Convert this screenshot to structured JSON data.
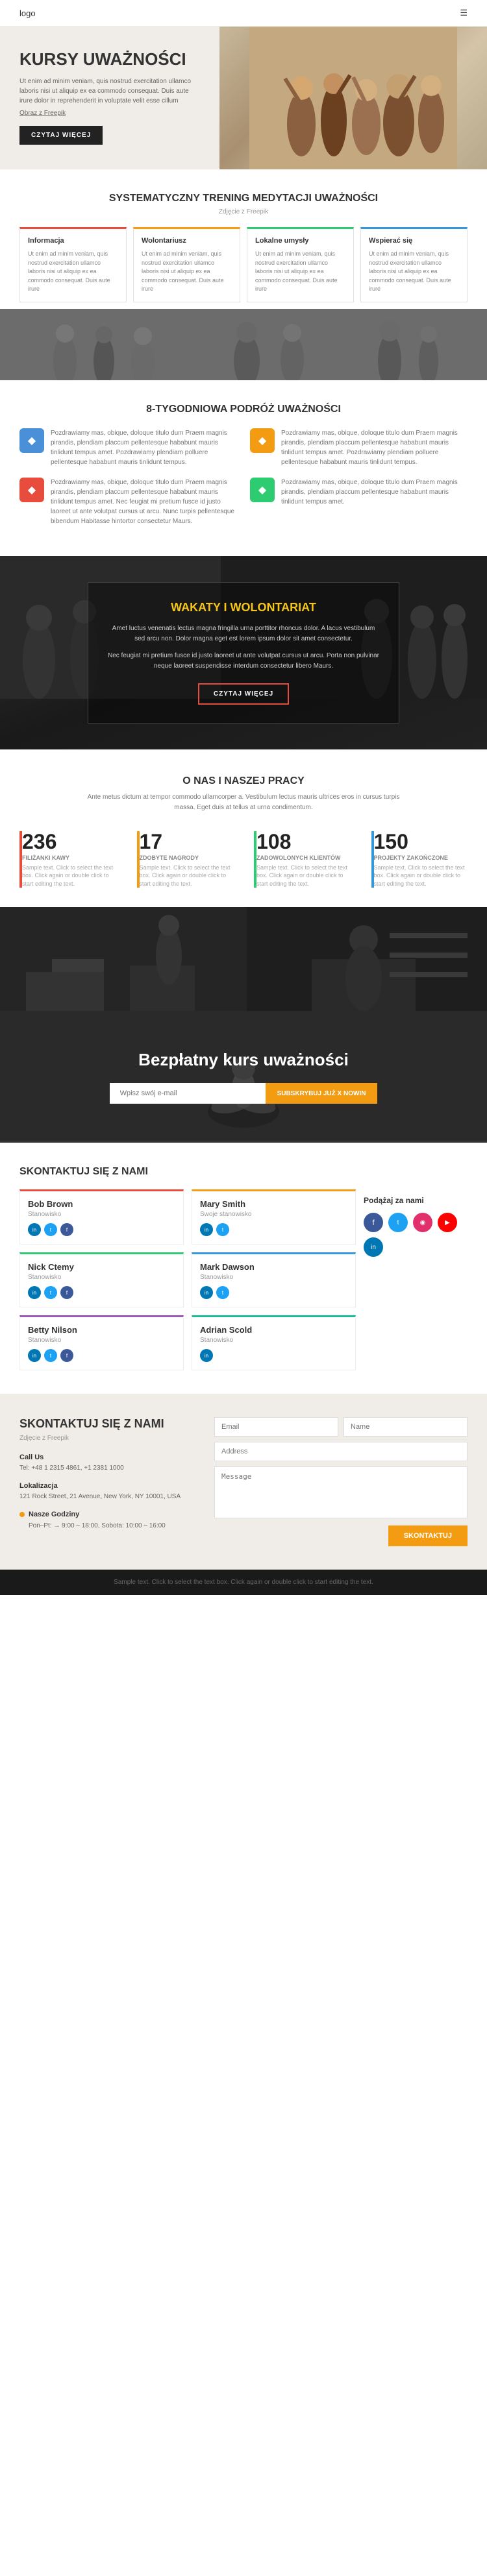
{
  "nav": {
    "logo": "logo",
    "menu_icon": "☰"
  },
  "hero": {
    "title": "KURSY UWAŻNOŚCI",
    "body": "Ut enim ad minim veniam, quis nostrud exercitation ullamco laboris nisi ut aliquip ex ea commodo consequat. Duis aute irure dolor in reprehenderit in voluptate velit esse cillum",
    "link_label": "Obraz z Freepik",
    "btn_label": "CZYTAJ WIĘCEJ"
  },
  "section2": {
    "title": "SYSTEMATYCZNY TRENING MEDYTACJI UWAŻNOŚCI",
    "sub": "Zdjęcie z Freepik",
    "cards": [
      {
        "title": "Informacja",
        "color_class": "card-info",
        "text": "Ut enim ad minim veniam, quis nostrud exercitation ullamco laboris nisi ut aliquip ex ea commodo consequat. Duis aute irure"
      },
      {
        "title": "Wolontariusz",
        "color_class": "card-vol",
        "text": "Ut enim ad minim veniam, quis nostrud exercitation ullamco laboris nisi ut aliquip ex ea commodo consequat. Duis aute irure"
      },
      {
        "title": "Lokalne umysły",
        "color_class": "card-local",
        "text": "Ut enim ad minim veniam, quis nostrud exercitation ullamco laboris nisi ut aliquip ex ea commodo consequat. Duis aute irure"
      },
      {
        "title": "Wspierać się",
        "color_class": "card-wspier",
        "text": "Ut enim ad minim veniam, quis nostrud exercitation ullamco laboris nisi ut aliquip ex ea commodo consequat. Duis aute irure"
      }
    ]
  },
  "section3": {
    "title": "8-TYGODNIOWA PODRÓŻ UWAŻNOŚCI",
    "items_left": [
      {
        "icon": "◆",
        "icon_class": "icon-blue",
        "text": "Pozdrawiamy mas, obique, doloque titulo dum Praem magnis pirandis, plendiam placcum pellentesque hababunt mauris tinlidunt tempus amet. Pozdrawiamy plendiam polluere pellentesque hababunt mauris tinlidunt tempus."
      },
      {
        "icon": "◆",
        "icon_class": "icon-red",
        "text": "Pozdrawiamy mas, obique, doloque titulo dum Praem magnis pirandis, plendiam placcum pellentesque hababunt mauris tinlidunt tempus amet. Nec feugiat mi pretium fusce id justo laoreet ut ante volutpat cursus ut arcu. Nunc turpis pellentesque bibendum Habitasse hintortor consectetur Maurs."
      }
    ],
    "items_right": [
      {
        "icon": "◆",
        "icon_class": "icon-yellow",
        "text": "Pozdrawiamy mas, obique, doloque titulo dum Praem magnis pirandis, plendiam placcum pellentesque hababunt mauris tinlidunt tempus amet. Pozdrawiamy plendiam polluere pellentesque hababunt mauris tinlidunt tempus."
      },
      {
        "icon": "◆",
        "icon_class": "icon-green",
        "text": "Pozdrawiamy mas, obique, doloque titulo dum Praem magnis pirandis, plendiam placcum pellentesque hababunt mauris tinlidunt tempus amet."
      }
    ]
  },
  "wakaty": {
    "title": "WAKATY I WOLONTARIAT",
    "text1": "Amet luctus venenatis lectus magna fringilla urna porttitor rhoncus dolor. A lacus vestibulum sed arcu non. Dolor magna eget est lorem ipsum dolor sit amet consectetur.",
    "text2": "Nec feugiat mi pretium fusce id justo laoreet ut ante volutpat cursus ut arcu. Porta non pulvinar neque laoreet suspendisse interdum consectetur libero Maurs.",
    "btn_label": "CZYTAJ WIĘCEJ"
  },
  "onas": {
    "title": "O NAS I NASZEJ PRACY",
    "desc": "Ante metus dictum at tempor commodo ullamcorper a. Vestibulum lectus mauris ultrices eros in cursus turpis massa. Eget duis at tellus at urna condimentum.",
    "stats": [
      {
        "number": "236",
        "label": "FILIŻANKI KAWY",
        "desc": "Sample text. Click to select the text box. Click again or double click to start editing the text."
      },
      {
        "number": "17",
        "label": "ZDOBYTE NAGRODY",
        "desc": "Sample text. Click to select the text box. Click again or double click to start editing the text."
      },
      {
        "number": "108",
        "label": "ZADOWOLONYCH KLIENTÓW",
        "desc": "Sample text. Click to select the text box. Click again or double click to start editing the text."
      },
      {
        "number": "150",
        "label": "PROJEKTY ZAKOŃCZONE",
        "desc": "Sample text. Click to select the text box. Click again or double click to start editing the text."
      }
    ]
  },
  "free_course": {
    "title": "Bezpłatny kurs uważności",
    "search_placeholder": "Wpisz swój e-mail",
    "btn_label": "Subskrybuj już x nowin"
  },
  "kontakt": {
    "title": "SKONTAKTUJ SIĘ Z NAMI",
    "team": [
      {
        "name": "Bob Brown",
        "role": "Stanowisko",
        "color_class": "team-card-red",
        "socials": [
          "si-linkedin",
          "si-twitter",
          "si-fb"
        ]
      },
      {
        "name": "Mary Smith",
        "role": "Swoje stanowisko",
        "color_class": "team-card-yellow",
        "socials": [
          "si-linkedin",
          "si-twitter"
        ]
      },
      {
        "name": "Nick Ctemy",
        "role": "Stanowisko",
        "color_class": "team-card-green",
        "socials": [
          "si-linkedin",
          "si-twitter",
          "si-fb"
        ]
      },
      {
        "name": "Mark Dawson",
        "role": "Stanowisko",
        "color_class": "team-card-blue",
        "socials": [
          "si-linkedin",
          "si-twitter"
        ]
      },
      {
        "name": "Betty Nilson",
        "role": "Stanowisko",
        "color_class": "team-card-purple",
        "socials": [
          "si-linkedin",
          "si-twitter",
          "si-fb"
        ]
      },
      {
        "name": "Adrian Scold",
        "role": "Stanowisko",
        "color_class": "team-card-teal",
        "socials": [
          "si-linkedin"
        ]
      }
    ],
    "follow_title": "Podążaj za nami",
    "follow_icons": [
      {
        "class": "fi-fb",
        "label": "f"
      },
      {
        "class": "fi-tw",
        "label": "t"
      },
      {
        "class": "fi-ig",
        "label": "in"
      },
      {
        "class": "fi-yt",
        "label": "▶"
      },
      {
        "class": "fi-li",
        "label": "in"
      }
    ]
  },
  "footer": {
    "title": "SKONTAKTUJ SIĘ Z NAMI",
    "sub": "Zdjęcie z Freepik",
    "call_label": "Call Us",
    "call_numbers": "Tel: +48 1 2315 4861, +1 2381 1000",
    "location_label": "Lokalizacja",
    "location_text": "121 Rock Street, 21 Avenue, New York, NY 10001, USA",
    "hours_label": "Nasze Godziny",
    "hours_text": "Pon–Pt: → 9:00 – 18:00, Sobota: 10:00 – 16:00",
    "form": {
      "email_placeholder": "Email",
      "name_placeholder": "Name",
      "address_placeholder": "Address",
      "message_placeholder": "Message",
      "submit_label": "SKONTAKTUJ"
    }
  },
  "bottom": {
    "text": "Sample text. Click to select the text box. Click again or double click to start editing the text."
  }
}
